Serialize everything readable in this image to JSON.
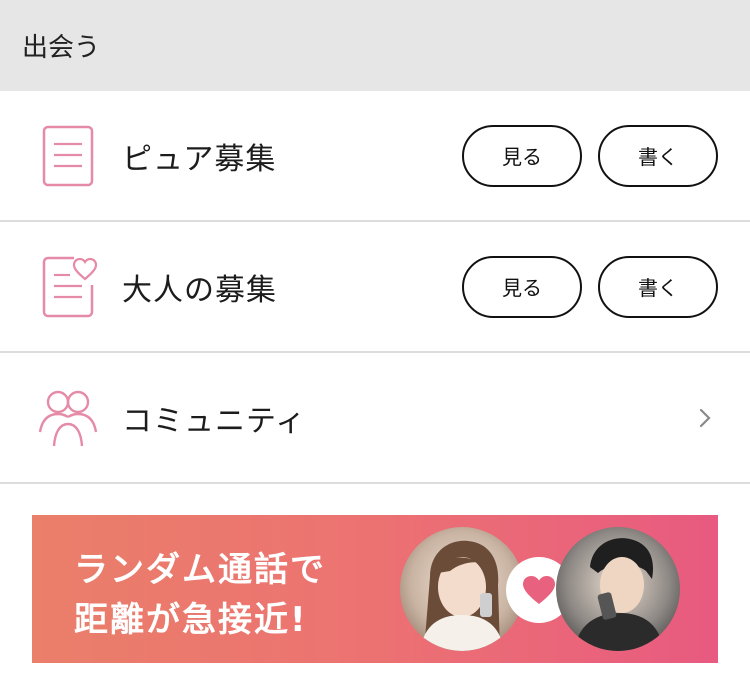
{
  "header": {
    "title": "出会う"
  },
  "rows": [
    {
      "label": "ピュア募集",
      "icon": "document-icon",
      "view_label": "見る",
      "write_label": "書く"
    },
    {
      "label": "大人の募集",
      "icon": "document-heart-icon",
      "view_label": "見る",
      "write_label": "書く"
    },
    {
      "label": "コミュニティ",
      "icon": "people-icon"
    }
  ],
  "banner": {
    "line1": "ランダム通話で",
    "line2": "距離が急接近!"
  },
  "colors": {
    "accent_pink": "#e58aa7",
    "banner_start": "#ea7f6a",
    "banner_end": "#e85a80"
  }
}
